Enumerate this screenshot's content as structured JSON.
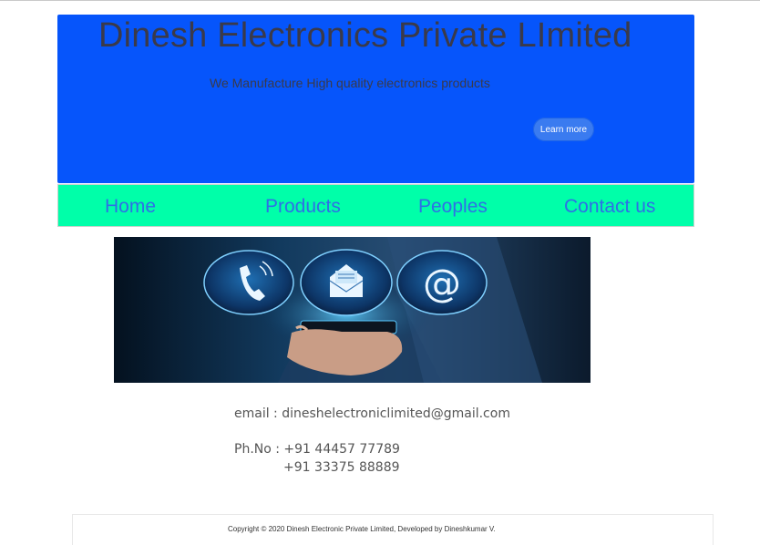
{
  "header": {
    "title": "Dinesh Electronics Private LImited",
    "subtitle": "We Manufacture High quality electronics  products",
    "cta_label": "Learn more"
  },
  "nav": {
    "items": [
      "Home",
      "Products",
      "Peoples",
      "Contact us"
    ]
  },
  "banner": {
    "icons": [
      "phone-icon",
      "mail-icon",
      "at-sign-icon"
    ],
    "at_symbol": "@"
  },
  "contact": {
    "email_line": "email : dineshelectroniclimited@gmail.com",
    "phone_line_1": "Ph.No : +91 44457 77789",
    "phone_line_2": "+91 33375 88889"
  },
  "footer": {
    "copyright": "Copyright © 2020 Dinesh Electronic Private Limited, Developed by Dineshkumar V."
  },
  "colors": {
    "hero_bg": "#0655fb",
    "nav_bg": "#00ffa9",
    "nav_text": "#2f6fe6",
    "button_bg": "#3a7bf0"
  }
}
